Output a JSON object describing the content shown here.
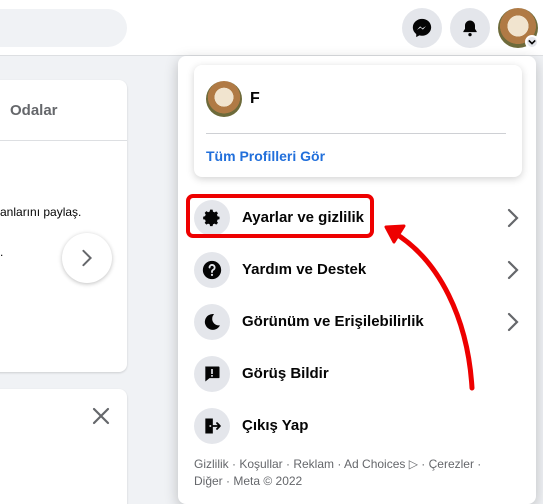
{
  "left": {
    "rooms_label": "Odalar",
    "share_text": "anlarını paylaş.",
    "dot_text": "."
  },
  "menu": {
    "profile": {
      "name": "F",
      "see_all_profiles": "Tüm Profilleri Gör"
    },
    "items": [
      {
        "label": "Ayarlar ve gizlilik",
        "icon": "gear-icon",
        "has_chevron": true
      },
      {
        "label": "Yardım ve Destek",
        "icon": "question-icon",
        "has_chevron": true
      },
      {
        "label": "Görünüm ve Erişilebilirlik",
        "icon": "moon-icon",
        "has_chevron": true
      },
      {
        "label": "Görüş Bildir",
        "icon": "feedback-icon",
        "has_chevron": false
      },
      {
        "label": "Çıkış Yap",
        "icon": "logout-icon",
        "has_chevron": false
      }
    ],
    "footer": {
      "line1": "Gizlilik · Koşullar · Reklam · Ad Choices ▷ · Çerezler ·",
      "line2": "Diğer · Meta © 2022"
    }
  },
  "colors": {
    "accent": "#216fdb",
    "annotation": "#ee0000",
    "icon_bg": "#e4e6eb"
  }
}
